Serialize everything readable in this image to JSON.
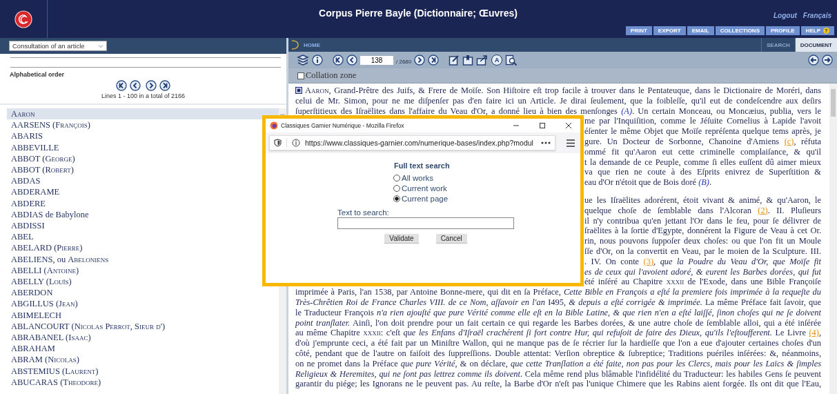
{
  "header": {
    "title": "Corpus Pierre Bayle (Dictionnaire; Œuvres)",
    "links": [
      "Logout",
      "Français"
    ],
    "buttons": [
      "PRINT",
      "EXPORT",
      "EMAIL",
      "COLLECTIONS",
      "PROFILE",
      "HELP"
    ],
    "help_badge": "?"
  },
  "left_panel": {
    "mode_select": {
      "value": "Consultation of an article"
    },
    "order_label": "Alphabetical order",
    "pager": "Lines 1 - 100 in a total of 2166",
    "articles": [
      {
        "parts": [
          {
            "kind": "smallcaps",
            "text": "Aaron"
          }
        ],
        "selected": true
      },
      {
        "parts": [
          "AARSENS ",
          {
            "kind": "smallcaps",
            "text": "(François)"
          }
        ],
        "selected": false
      },
      {
        "parts": [
          "ABARIS"
        ],
        "selected": false
      },
      {
        "parts": [
          "ABBEVILLE"
        ],
        "selected": false
      },
      {
        "parts": [
          "ABBOT ",
          {
            "kind": "smallcaps",
            "text": "(George)"
          }
        ],
        "selected": false
      },
      {
        "parts": [
          "ABBOT ",
          {
            "kind": "smallcaps",
            "text": "(Robert)"
          }
        ],
        "selected": false
      },
      {
        "parts": [
          "ABDAS"
        ],
        "selected": false
      },
      {
        "parts": [
          "ABDERAME"
        ],
        "selected": false
      },
      {
        "parts": [
          "ABDERE"
        ],
        "selected": false
      },
      {
        "parts": [
          "ABDIAS de Babylone"
        ],
        "selected": false
      },
      {
        "parts": [
          "ABDISSI"
        ],
        "selected": false
      },
      {
        "parts": [
          "ABEL"
        ],
        "selected": false
      },
      {
        "parts": [
          "ABELARD ",
          {
            "kind": "smallcaps",
            "text": "(Pierre)"
          }
        ],
        "selected": false
      },
      {
        "parts": [
          "ABELIENS, ou ",
          {
            "kind": "smallcaps",
            "text": "Abeloniens"
          }
        ],
        "selected": false
      },
      {
        "parts": [
          "ABELLI ",
          {
            "kind": "smallcaps",
            "text": "(Antoine)"
          }
        ],
        "selected": false
      },
      {
        "parts": [
          "ABELLY ",
          {
            "kind": "smallcaps",
            "text": "(Louïs)"
          }
        ],
        "selected": false
      },
      {
        "parts": [
          "ABERDON"
        ],
        "selected": false
      },
      {
        "parts": [
          "ABGILLUS ",
          {
            "kind": "smallcaps",
            "text": "(Jean)"
          }
        ],
        "selected": false
      },
      {
        "parts": [
          "ABIMELECH"
        ],
        "selected": false
      },
      {
        "parts": [
          "ABLANCOURT ",
          {
            "kind": "smallcaps",
            "text": "(Nicolas Perrot, Sieur d')"
          }
        ],
        "selected": false
      },
      {
        "parts": [
          "ABRABANEL ",
          {
            "kind": "smallcaps",
            "text": "(Isaac)"
          }
        ],
        "selected": false
      },
      {
        "parts": [
          "ABRAHAM"
        ],
        "selected": false
      },
      {
        "parts": [
          "ABRAM ",
          {
            "kind": "smallcaps",
            "text": "(Nicolas)"
          }
        ],
        "selected": false
      },
      {
        "parts": [
          "ABSTEMIUS ",
          {
            "kind": "smallcaps",
            "text": "(Laurent)"
          }
        ],
        "selected": false
      },
      {
        "parts": [
          "ABUCARAS ",
          {
            "kind": "smallcaps",
            "text": "(Theodore)"
          }
        ],
        "selected": false
      }
    ]
  },
  "document": {
    "home": "HOME",
    "view_tabs": [
      {
        "label": "SEARCH",
        "selected": false
      },
      {
        "label": "DOCUMENT",
        "selected": true
      }
    ],
    "page": "138",
    "page_total": "/ 2680",
    "toolbar_letter": "A",
    "collation": {
      "label": "Collation zone",
      "checked": false
    },
    "paragraphs": [
      {
        "lines": [
          {
            "kind": "first",
            "parts": [
              {
                "kind": "smallcaps",
                "text": "Aaron"
              },
              ", Grand-Prêtre des Juifs, & Frere de Moïſe. Son Hiſtoire eſt trop facile à trouver dans le Pentateuque, dans le Dictionaire de Moréri, dans"
            ]
          },
          {
            "kind": "full",
            "parts": [
              "celui de Mr. Simon, pour ne me diſpenſer pas d'en faire ici un Article. Je dirai ſeulement, que la foibleſſe, qu'il eut de condeſcendre aux deſirs"
            ]
          },
          {
            "kind": "full",
            "parts": [
              "ſuperſtitieux des Iſraëlites dans l'affaire du Veau d'Or, a donné lieu à bien des menſonges ",
              {
                "kind": "ref",
                "text": "(A)"
              },
              ". Un certain Monceau, ou Moncæius, publia, vers le"
            ]
          },
          {
            "kind": "tail",
            "parts": [
              "me par l'Inquiſition, comme le Jéſuite Cornelius à Lapide l'avoit"
            ]
          },
          {
            "kind": "tail",
            "parts": [
              "éſenter le même Objet que Moïſe repréſenta quelque tems après, je"
            ]
          },
          {
            "kind": "tail",
            "parts": [
              "gure. Un Docteur de Sorbonne, Chanoine d'Amiens ",
              {
                "kind": "note",
                "text": "(c)"
              },
              ", réfuta"
            ]
          },
          {
            "kind": "tail",
            "parts": [
              "ommé fit qu'Aaron eut cette criminelle complaiſance, & qu'il"
            ]
          },
          {
            "kind": "tail",
            "parts": [
              "t la demande de ce Peuple, comme ſi elles euſſent dû aimer mieux"
            ]
          },
          {
            "kind": "tail",
            "parts": [
              "va que rien ne coute à des Eſprits enivrez de Superſtition &"
            ]
          },
          {
            "kind": "tail_end",
            "parts": [
              "eau d'Or n'étoit que de Bois doré ",
              {
                "kind": "ref",
                "text": "(B)"
              },
              "."
            ]
          }
        ]
      },
      {
        "lines": [
          {
            "kind": "tail",
            "parts": [
              "ue les Iſraëlites adorérent, étoit vivant & animé, & qu'Aaron, le"
            ]
          },
          {
            "kind": "tail",
            "parts": [
              "quelque choſe de ſemblable dans l'Alcoran ",
              {
                "kind": "note",
                "text": "(2)"
              },
              ". II. Pluſieurs"
            ]
          },
          {
            "kind": "tail",
            "parts": [
              "il n'y contribua qu'en jettant l'Or dans le feu, pour ſe délivrer de"
            ]
          },
          {
            "kind": "tail",
            "parts": [
              "ſraëlites à la ſortie d'Egypte, donnérent la Figure de Veau à cet Or."
            ]
          },
          {
            "kind": "tail",
            "parts": [
              "rin, nous pouvons ſuppoſer deux choſes: ou que l'on fit un Moule"
            ]
          },
          {
            "kind": "tail",
            "parts": [
              "ſſe d'Or, on la convertit en Veau, par le moien de la Sculpture. III."
            ]
          },
          {
            "kind": "tail",
            "parts": [
              ". IV. On conte ",
              {
                "kind": "note",
                "text": "(3)"
              },
              ", ",
              {
                "kind": "italic",
                "text": "que la Poudre du Veau d'Or, que Moïſe fit"
              }
            ]
          },
          {
            "kind": "tail",
            "parts": [
              {
                "kind": "italic",
                "text": "es de ceux qui l'avoient adoré, & eurent les Barbes dorées, qui fut"
              }
            ]
          },
          {
            "kind": "tail",
            "parts": [
              "été inſéré au Chapitre ",
              {
                "kind": "smallcaps",
                "text": "xxxii"
              },
              " de l'Exode, dans une Bible Françoiſe"
            ]
          },
          {
            "kind": "full",
            "parts": [
              "imprimée à Paris, l'an 1538, par Antoine Bonne-mere, qui dit en ſa Préface, ",
              {
                "kind": "italic",
                "text": "Cette Bible en François a eſté la premiere fois imprimée à la requeſte du"
              }
            ]
          },
          {
            "kind": "full",
            "parts": [
              {
                "kind": "italic",
                "text": "Très-Chrêtien Roi de France Charles VIII. de ce Nom, aſſavoir en l'an "
              },
              "I495",
              {
                "kind": "italic",
                "text": ", & depuis a eſté corrigée & imprimée."
              },
              " La même Préface fait ſavoir, que"
            ]
          },
          {
            "kind": "full",
            "parts": [
              "le Traducteur François ",
              {
                "kind": "italic",
                "text": "n'a rien ajouſté que pure Vérité comme elle eſt en la Bible Latine, & que rien n'en a eſté laiſſé, ſinon choſes qui ne ſe doivent"
              }
            ]
          },
          {
            "kind": "full",
            "parts": [
              {
                "kind": "italic",
                "text": "point tranſlater."
              },
              " Ainſi, l'on doit prendre pour un fait certain ce qui regarde les Barbes dorées, & une autre choſe de ſemblable alloi, qui a été inſérée"
            ]
          },
          {
            "kind": "full",
            "parts": [
              "au même Chapitre ",
              {
                "kind": "smallcaps",
                "text": "xxxii"
              },
              ": c'eſt ",
              {
                "kind": "italic",
                "text": "que les Enfans d'Iſraël crachérent ſi fort contre Hur, qui refuſoit de faire des Dieux, qu'ils l'eſtoufferent."
              },
              " Le Livre ",
              {
                "kind": "note",
                "text": "(4)"
              },
              ","
            ]
          },
          {
            "kind": "full",
            "parts": [
              "d'où j'emprunte ceci, a été fait par un Miniſtre Wallon, qui ne manque pas de ſe récrier ſur la hardieſſe que l'on a eue d'ajouter certaines choſes d'un"
            ]
          },
          {
            "kind": "full",
            "parts": [
              "côté, pendant que de l'autre on faiſoit des ſuppreſſions. Double attentat: Verſion obreptice & ſubreptice; Traditions puériles inſérées: &, néanmoins,"
            ]
          },
          {
            "kind": "full",
            "parts": [
              "on ne promet dans la Préface ",
              {
                "kind": "italic",
                "text": "que pure Vérité"
              },
              ", & on déclare, ",
              {
                "kind": "italic",
                "text": "que cette Tranſlation a été faite, non pas pour les Clercs, mais pour les Laïcs & ſimples"
              }
            ]
          },
          {
            "kind": "full",
            "parts": [
              {
                "kind": "italic",
                "text": "Religieux & Heremites, qui ne ſont pas lettrez comme ils doivent"
              },
              ". Cela même rend plus blâmable l'infidélité du Traducteur: les habiles Gens ſe peuvent"
            ]
          },
          {
            "kind": "full",
            "parts": [
              "garantir du piége; les Ignorans ne le peuvent pas. Au reſte, la Barbe d'Or n'eſt pas l'unique Chimere que les Rabins aient forgée. Ils ont dit que l'Eau,"
            ]
          }
        ]
      }
    ]
  },
  "popup": {
    "title": "Classiques Garnier Numérique - Mozilla Firefox",
    "url": "https://www.classiques-garnier.com/numerique-bases/index.php?modul",
    "heading": "Full text search",
    "options": [
      {
        "label": "All works",
        "selected": false
      },
      {
        "label": "Current work",
        "selected": false
      },
      {
        "label": "Current page",
        "selected": true
      }
    ],
    "field_label": "Text to search:",
    "buttons": [
      "Validate",
      "Cancel"
    ]
  }
}
